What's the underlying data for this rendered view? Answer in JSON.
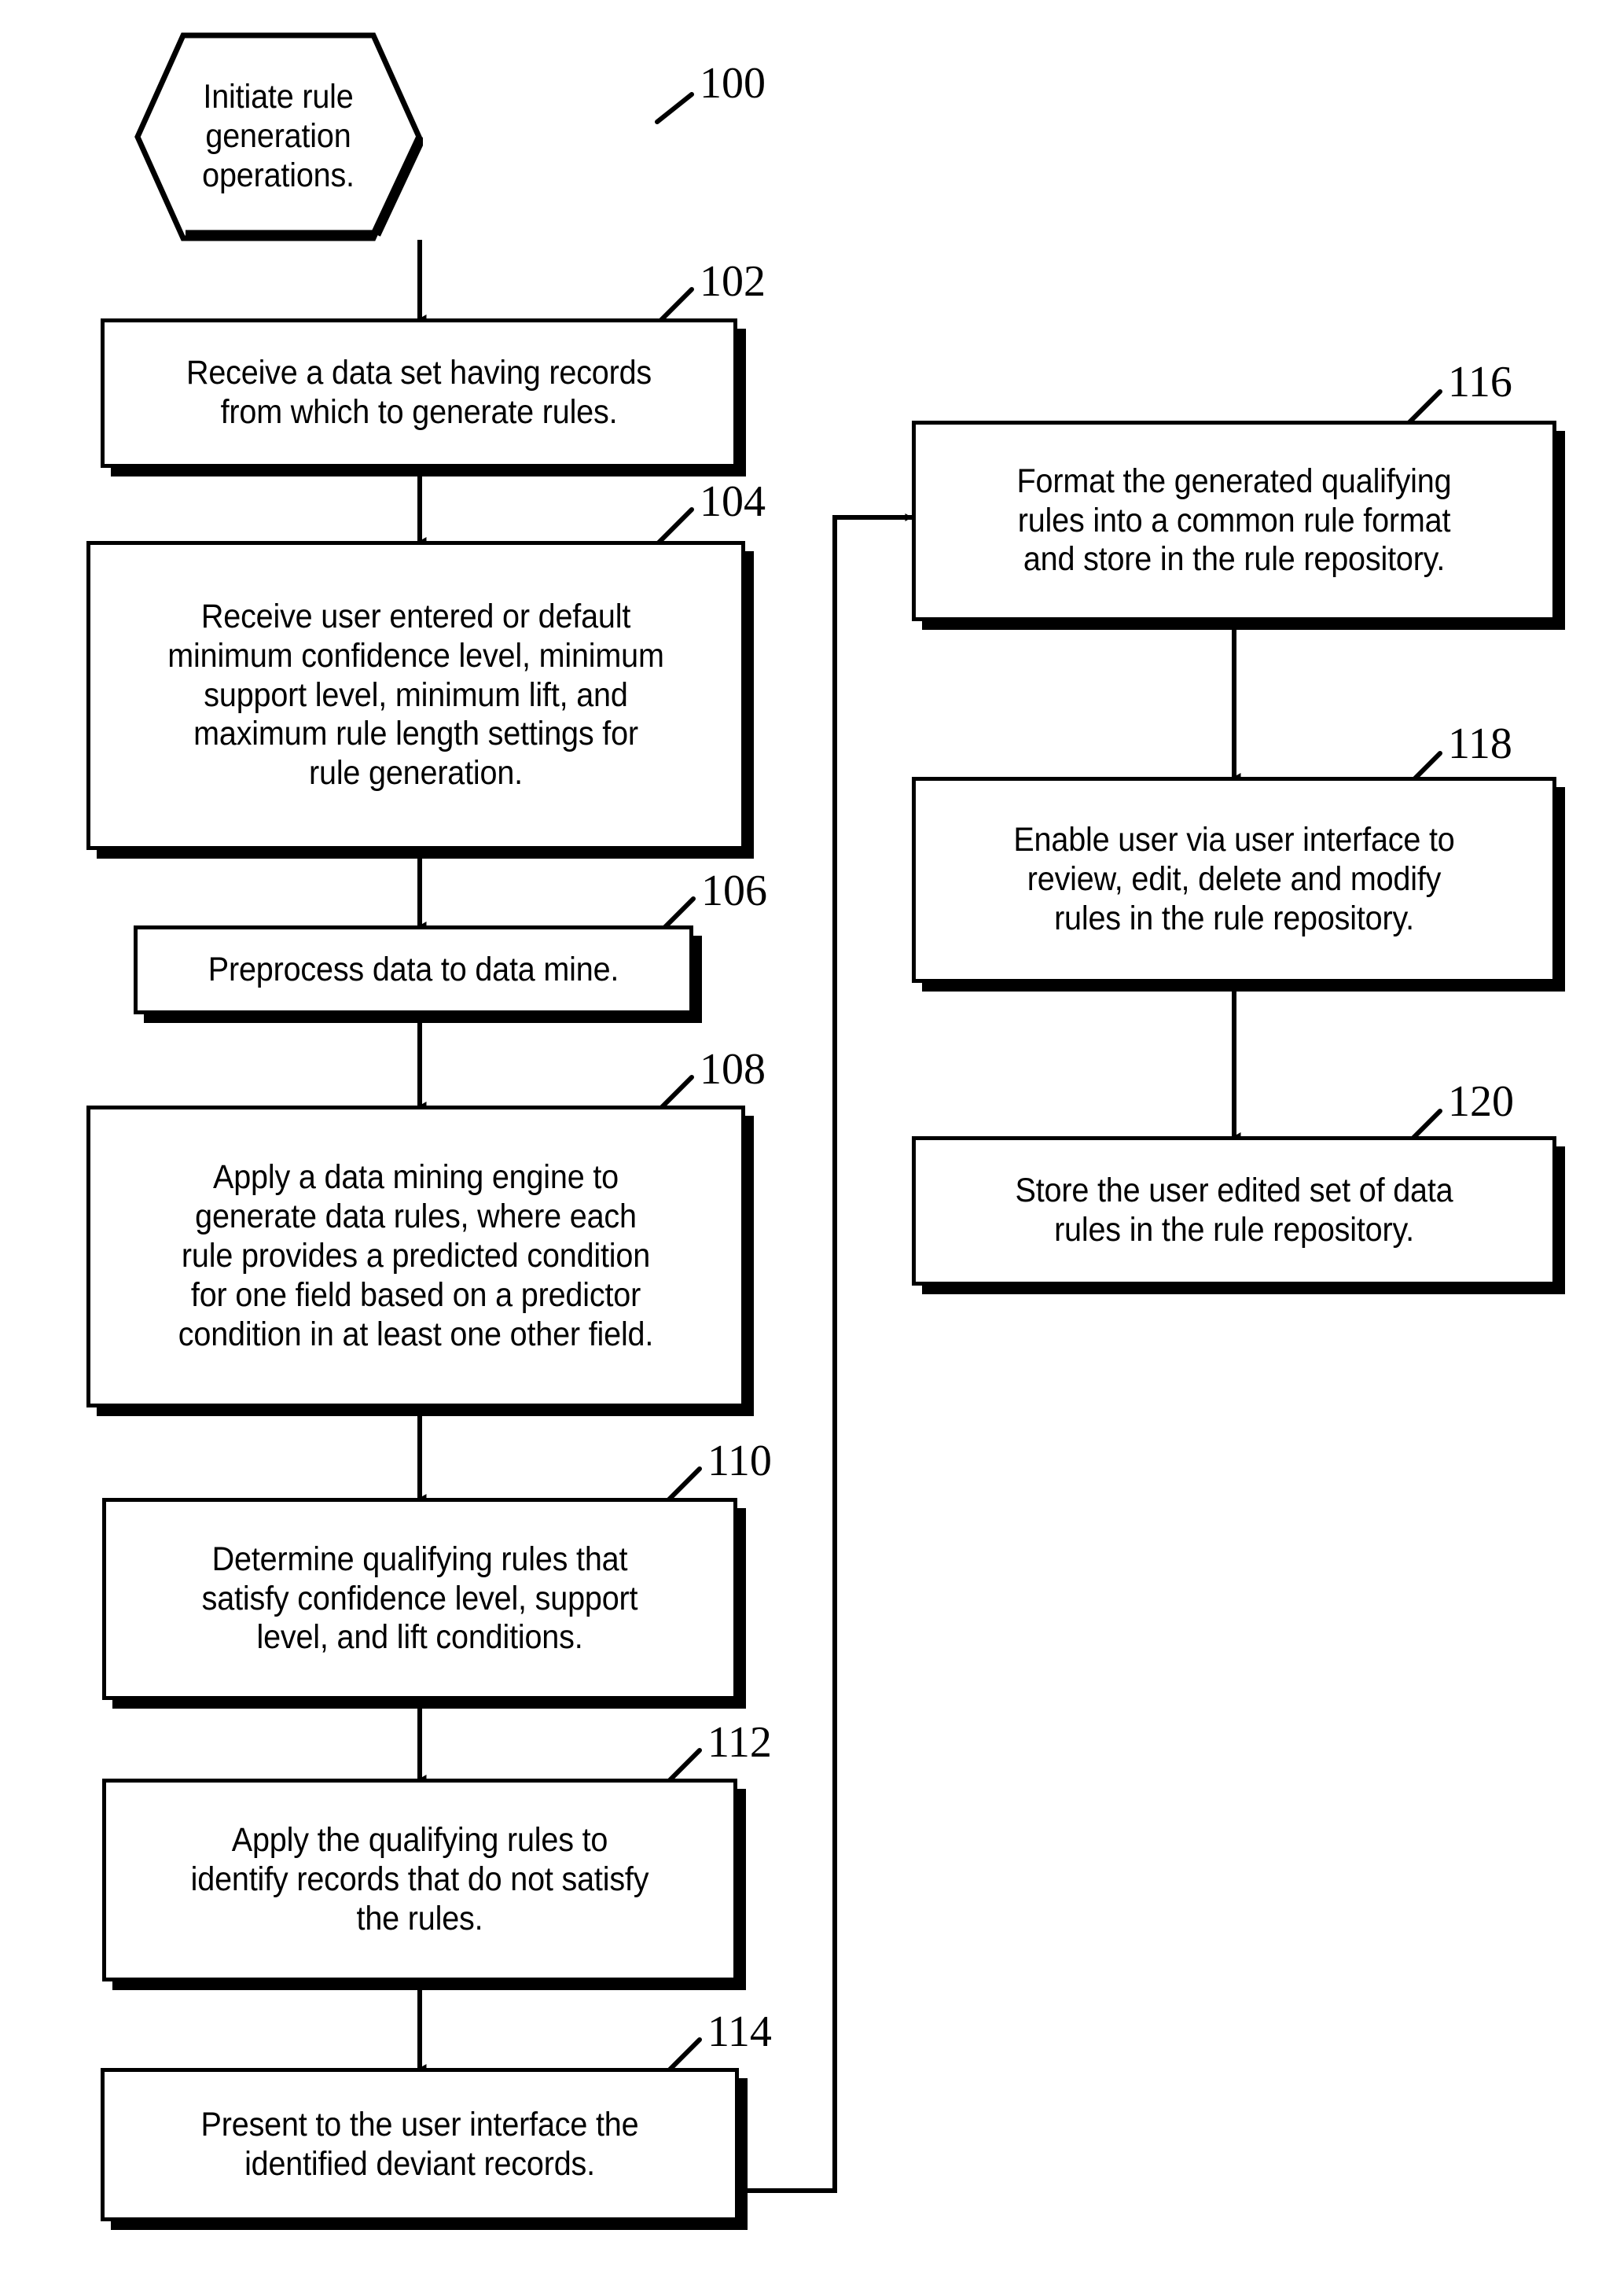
{
  "figure": {
    "kind": "patent-flowchart",
    "background_color": "#ffffff",
    "line_color": "#000000"
  },
  "nodes": [
    {
      "id": "start",
      "shape": "hexagon",
      "ref": "100",
      "text": "Initiate rule generation\noperations."
    },
    {
      "id": "receive-data-set",
      "shape": "process",
      "ref": "102",
      "text": "Receive a data set having records\nfrom which to generate rules."
    },
    {
      "id": "receive-settings",
      "shape": "process",
      "ref": "104",
      "text": "Receive user entered or default\nminimum confidence level, minimum\nsupport level, minimum lift, and\nmaximum rule length settings for\nrule generation."
    },
    {
      "id": "preprocess-data",
      "shape": "process",
      "ref": "106",
      "text": "Preprocess data to data mine."
    },
    {
      "id": "apply-mining-engine",
      "shape": "process",
      "ref": "108",
      "text": "Apply a data mining engine to\ngenerate data rules, where each\nrule provides a predicted condition\nfor one field based on a predictor\ncondition in at least one other field."
    },
    {
      "id": "determine-qualifying-rules",
      "shape": "process",
      "ref": "110",
      "text": "Determine qualifying rules that\nsatisfy confidence level, support\nlevel, and lift conditions."
    },
    {
      "id": "apply-qualifying-rules",
      "shape": "process",
      "ref": "112",
      "text": "Apply the qualifying rules to\nidentify records that do not satisfy\nthe rules."
    },
    {
      "id": "present-deviant-records",
      "shape": "process",
      "ref": "114",
      "text": "Present to the user interface the\nidentified deviant records."
    },
    {
      "id": "format-and-store",
      "shape": "process",
      "ref": "116",
      "text": "Format the generated qualifying\nrules into a common rule format\nand store in the rule repository."
    },
    {
      "id": "enable-user-review",
      "shape": "process",
      "ref": "118",
      "text": "Enable user via user interface to\nreview, edit, delete and modify\nrules in the rule repository."
    },
    {
      "id": "store-edited-rules",
      "shape": "process",
      "ref": "120",
      "text": "Store the user edited set of data\nrules in the rule repository."
    }
  ],
  "edges": [
    {
      "id": "e-100-102",
      "from": "start",
      "to": "receive-data-set",
      "style": "arrow-down"
    },
    {
      "id": "e-102-104",
      "from": "receive-data-set",
      "to": "receive-settings",
      "style": "arrow-down"
    },
    {
      "id": "e-104-106",
      "from": "receive-settings",
      "to": "preprocess-data",
      "style": "arrow-down"
    },
    {
      "id": "e-106-108",
      "from": "preprocess-data",
      "to": "apply-mining-engine",
      "style": "arrow-down"
    },
    {
      "id": "e-108-110",
      "from": "apply-mining-engine",
      "to": "determine-qualifying-rules",
      "style": "arrow-down"
    },
    {
      "id": "e-110-112",
      "from": "determine-qualifying-rules",
      "to": "apply-qualifying-rules",
      "style": "arrow-down"
    },
    {
      "id": "e-112-114",
      "from": "apply-qualifying-rules",
      "to": "present-deviant-records",
      "style": "arrow-down"
    },
    {
      "id": "e-114-116",
      "from": "present-deviant-records",
      "to": "format-and-store",
      "style": "elbow-right-up-arrow-right"
    },
    {
      "id": "e-116-118",
      "from": "format-and-store",
      "to": "enable-user-review",
      "style": "arrow-down"
    },
    {
      "id": "e-118-120",
      "from": "enable-user-review",
      "to": "store-edited-rules",
      "style": "arrow-down"
    }
  ]
}
